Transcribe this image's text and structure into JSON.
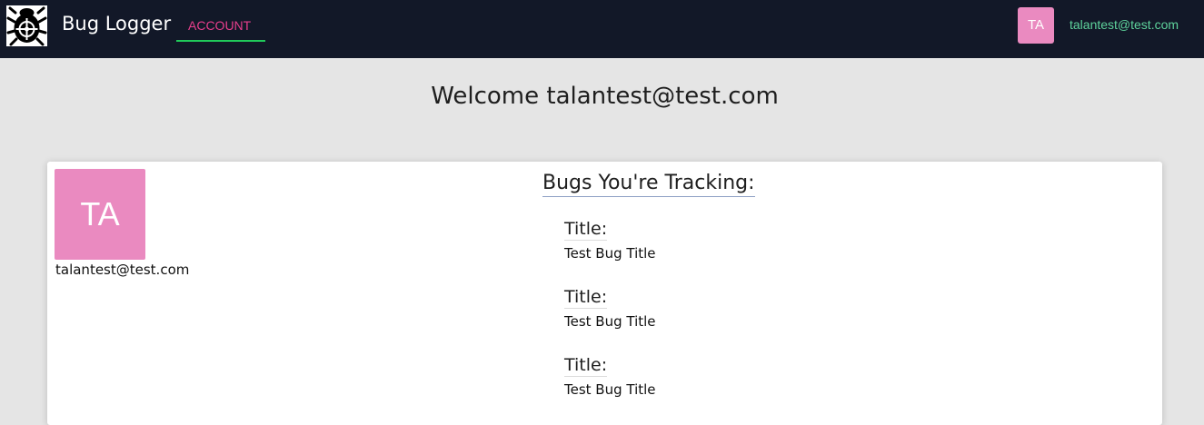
{
  "navbar": {
    "logo_icon": "bug-crosshair-icon",
    "brand": "Bug Logger",
    "account_link": "ACCOUNT",
    "avatar_initials": "TA",
    "user_email": "talantest@test.com",
    "colors": {
      "background": "#121828",
      "account_link": "#e83e8c",
      "active_underline": "#20c95a",
      "email": "#5ed39c",
      "avatar": "#ea8ac0"
    }
  },
  "welcome": "Welcome talantest@test.com",
  "profile": {
    "avatar_initials": "TA",
    "email": "talantest@test.com"
  },
  "bugs": {
    "heading": "Bugs You're Tracking:",
    "items": [
      {
        "label": "Title:",
        "title": "Test Bug Title"
      },
      {
        "label": "Title:",
        "title": "Test Bug Title"
      },
      {
        "label": "Title:",
        "title": "Test Bug Title"
      }
    ]
  }
}
